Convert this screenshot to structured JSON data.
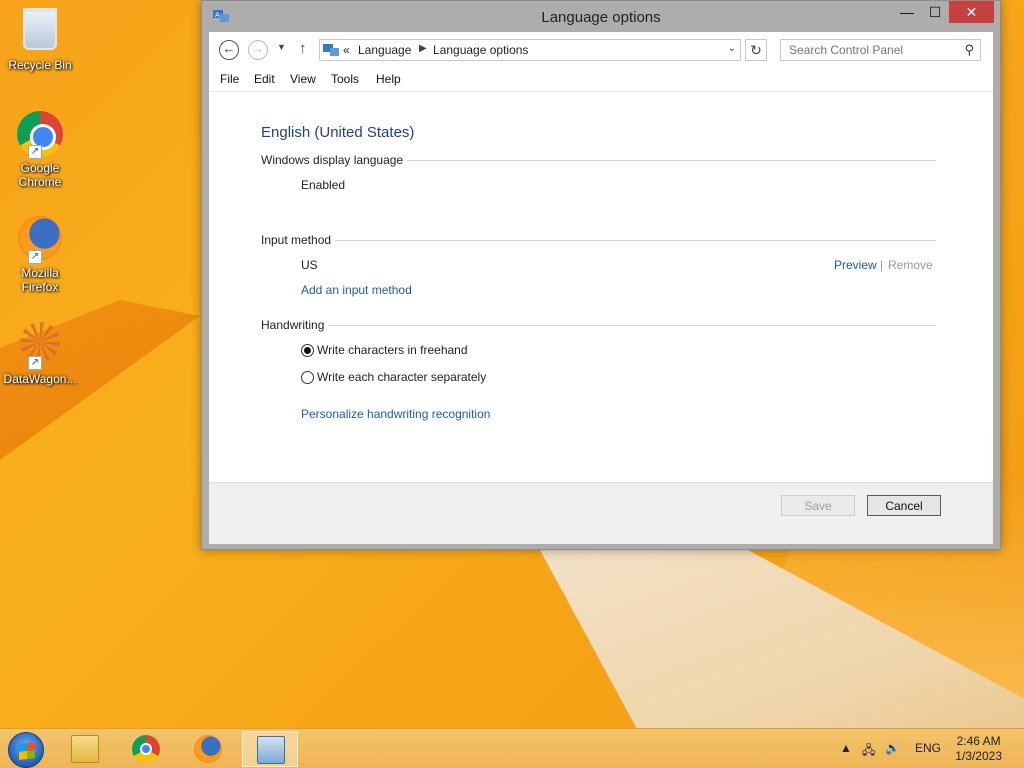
{
  "desktop": {
    "icons": [
      {
        "label": "Recycle Bin"
      },
      {
        "label": "Google Chrome"
      },
      {
        "label": "Mozilla Firefox"
      },
      {
        "label": "DataWagon..."
      }
    ]
  },
  "window": {
    "title": "Language options",
    "controls": {
      "minimize": "—",
      "maximize": "☐",
      "close": "✕"
    }
  },
  "address": {
    "prefix": "«",
    "crumbs": [
      "Language",
      "Language options"
    ],
    "search_placeholder": "Search Control Panel"
  },
  "menu": [
    "File",
    "Edit",
    "View",
    "Tools",
    "Help"
  ],
  "content": {
    "language_name": "English (United States)",
    "display_section": {
      "heading": "Windows display language",
      "status": "Enabled"
    },
    "input_section": {
      "heading": "Input method",
      "method": "US",
      "preview_link": "Preview",
      "separator": "|",
      "remove_link": "Remove",
      "add_link": "Add an input method"
    },
    "handwriting_section": {
      "heading": "Handwriting",
      "options": [
        {
          "label": "Write characters in freehand",
          "selected": true
        },
        {
          "label": "Write each character separately",
          "selected": false
        }
      ],
      "personalize_link": "Personalize handwriting recognition"
    }
  },
  "footer": {
    "save_label": "Save",
    "cancel_label": "Cancel"
  },
  "taskbar": {
    "tray_lang": "ENG",
    "time": "2:46 AM",
    "date": "1/3/2023"
  },
  "colors": {
    "link": "#1f5aa8",
    "title": "#1f3f8f",
    "close_button": "#c74040"
  }
}
